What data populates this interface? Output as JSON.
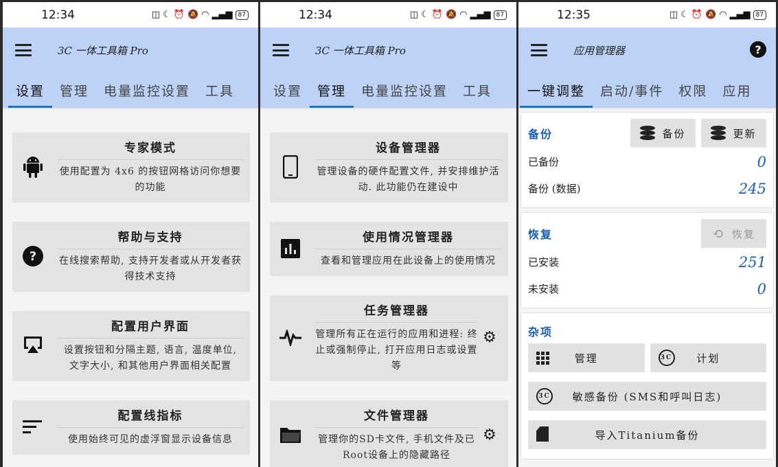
{
  "screens": [
    {
      "time": "12:34",
      "battery": "87",
      "title": "3C 一体工具箱 Pro",
      "tabs": [
        "设置",
        "管理",
        "电量监控设置",
        "工具"
      ],
      "active_tab": 0,
      "cards": [
        {
          "icon": "android-icon",
          "title": "专家模式",
          "desc": "使用配置为 4x6 的按钮网格访问你想要的功能"
        },
        {
          "icon": "help-circle-icon",
          "title": "帮助与支持",
          "desc": "在线搜索帮助, 支持开发者或从开发者获得技术支持"
        },
        {
          "icon": "airplay-icon",
          "title": "配置用户界面",
          "desc": "设置按钮和分隔主题, 语言, 温度单位, 文字大小, 和其他用户界面相关配置"
        },
        {
          "icon": "sort-lines-icon",
          "title": "配置线指标",
          "desc": "使用始终可见的虚浮窗显示设备信息"
        }
      ]
    },
    {
      "time": "12:34",
      "battery": "87",
      "title": "3C 一体工具箱 Pro",
      "tabs": [
        "设置",
        "管理",
        "电量监控设置",
        "工具"
      ],
      "active_tab": 1,
      "cards": [
        {
          "icon": "smartphone-icon",
          "title": "设备管理器",
          "desc": "管理设备的硬件配置文件, 并安排维护活动. 此功能仍在建设中"
        },
        {
          "icon": "bar-chart-icon",
          "title": "使用情况管理器",
          "desc": "查看和管理应用在此设备上的使用情况"
        },
        {
          "icon": "pulse-icon",
          "title": "任务管理器",
          "desc": "管理所有正在运行的应用和进程: 终止或强制停止, 打开应用日志或设置等",
          "gear": true
        },
        {
          "icon": "folder-icon",
          "title": "文件管理器",
          "desc": "管理你的SD卡文件, 手机文件及已Root设备上的隐藏路径",
          "gear": true
        }
      ]
    }
  ],
  "app_manager": {
    "time": "12:35",
    "battery": "87",
    "title": "应用管理器",
    "tabs": [
      "一键调整",
      "启动/事件",
      "权限",
      "应用"
    ],
    "active_tab": 0,
    "backup": {
      "title": "备份",
      "btn_backup": "备份",
      "btn_update": "更新",
      "rows": [
        {
          "label": "已备份",
          "value": "0"
        },
        {
          "label": "备份 (数据)",
          "value": "245"
        }
      ]
    },
    "restore": {
      "title": "恢复",
      "btn_restore": "恢复",
      "rows": [
        {
          "label": "已安装",
          "value": "251"
        },
        {
          "label": "未安装",
          "value": "0"
        }
      ]
    },
    "misc": {
      "title": "杂项",
      "btn_manage": "管理",
      "btn_schedule": "计划",
      "btn_sensitive": "敏感备份 (SMS和呼叫日志)",
      "btn_titanium": "导入Titanium备份"
    }
  }
}
